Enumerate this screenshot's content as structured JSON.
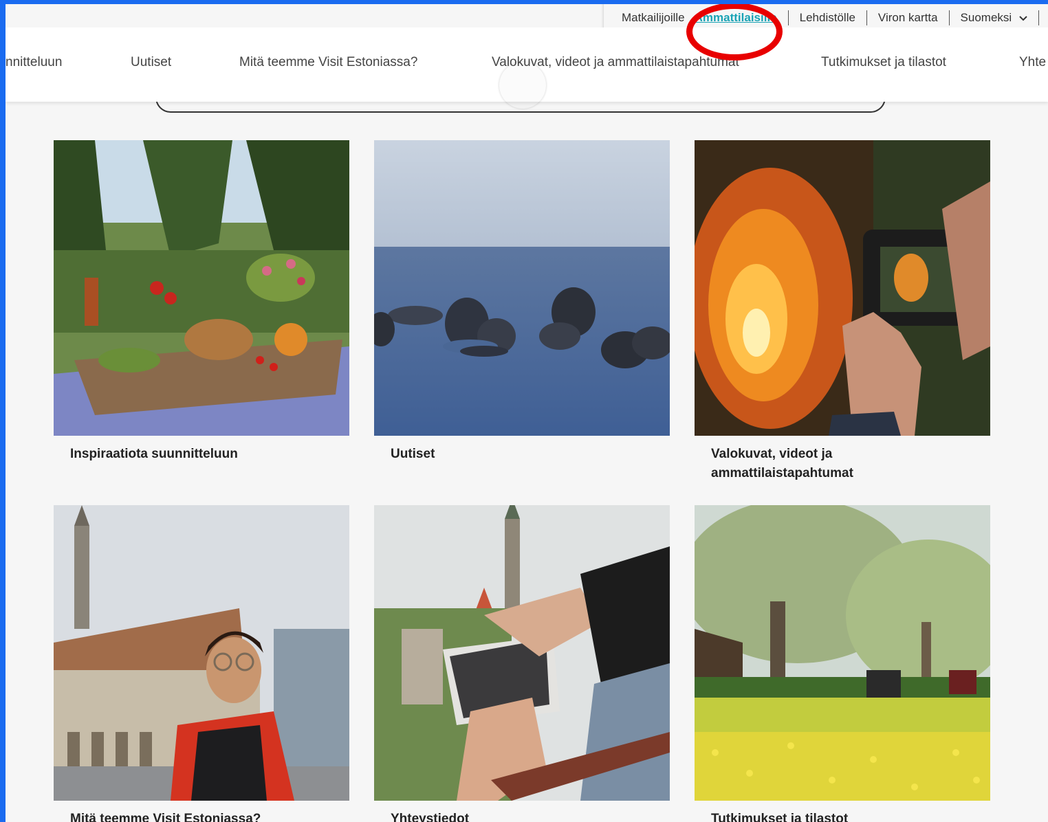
{
  "utility_nav": {
    "items": [
      {
        "label": "Matkailijoille"
      },
      {
        "label": "Ammattilaisille"
      },
      {
        "label": "Lehdistölle"
      },
      {
        "label": "Viron kartta"
      },
      {
        "label": "Suomeksi"
      }
    ],
    "active_index": 1,
    "accent_color": "#1aa3b5",
    "highlight_color": "#e80000"
  },
  "main_nav": {
    "items": [
      {
        "label": "nnitteluun"
      },
      {
        "label": "Uutiset"
      },
      {
        "label": "Mitä teemme Visit Estoniassa?"
      },
      {
        "label": "Valokuvat, videot ja ammattilaistapahtumat"
      },
      {
        "label": "Tutkimukset ja tilastot"
      },
      {
        "label": "Yhte"
      }
    ]
  },
  "cards": [
    {
      "caption": "Inspiraatiota suunnitteluun",
      "image": "outdoor-food-table-photo"
    },
    {
      "caption": "Uutiset",
      "image": "seals-in-sea-photo"
    },
    {
      "caption": "Valokuvat, videot ja ammattilaistapahtumat",
      "image": "camera-bonfire-photo"
    },
    {
      "caption": "Mitä teemme Visit Estoniassa?",
      "image": "town-hall-man-photo"
    },
    {
      "caption": "Yhteystiedot",
      "image": "tablet-old-town-photo"
    },
    {
      "caption": "Tutkimukset ja tilastot",
      "image": "blooming-orchard-photo"
    }
  ],
  "icons": {
    "dropdown": "chevron-down-icon"
  }
}
